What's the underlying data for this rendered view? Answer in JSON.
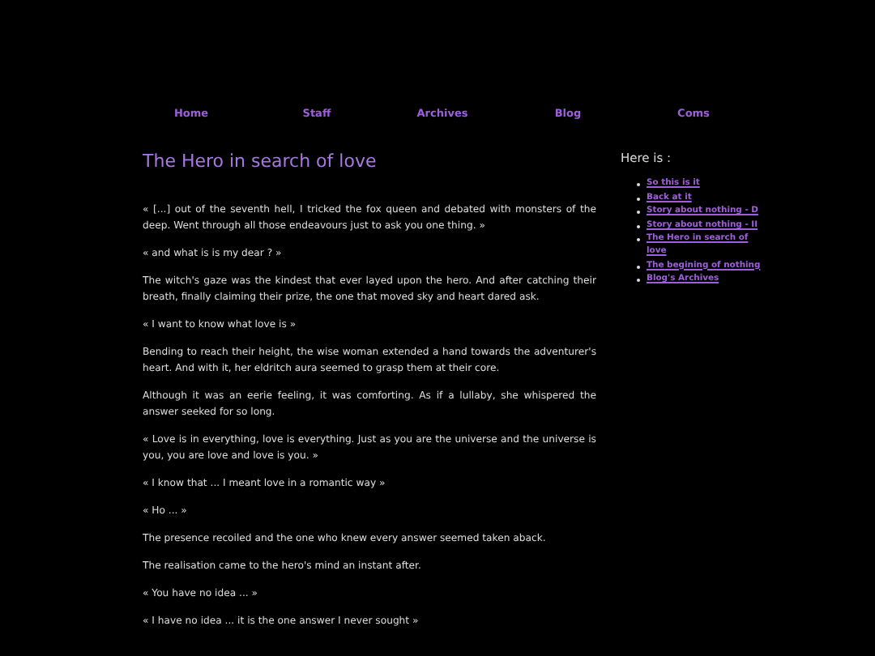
{
  "nav": [
    {
      "label": "Home"
    },
    {
      "label": "Staff"
    },
    {
      "label": "Archives"
    },
    {
      "label": "Blog"
    },
    {
      "label": "Coms"
    }
  ],
  "post": {
    "title": "The Hero in search of love",
    "paragraphs": [
      "« [...] out of the seventh hell, I tricked the fox queen and debated with monsters of the deep. Went through all those endeavours just to ask you one thing. »",
      "« and what is is my dear ? »",
      "The witch's gaze was the kindest that ever layed upon the hero. And after catching their breath, finally claiming their prize, the one that moved sky and heart dared ask.",
      "« I want to know what love is »",
      "Bending to reach their height, the wise woman extended a hand towards the adventurer's heart. And with it, her eldritch aura seemed to grasp them at their core.",
      "Although it was an eerie feeling, it was comforting. As if a lullaby, she whispered the answer seeked for so long.",
      "« Love is in everything, love is everything. Just as you are the universe and the universe is you, you are love and love is you. »",
      "« I know that ... I meant love in a romantic way »",
      "« Ho ... »",
      "The presence recoiled and the one who knew every answer seemed taken aback.",
      "The realisation came to the hero's mind an instant after.",
      "« You have no idea ... »",
      "« I have no idea ... it is the one answer I never sought »"
    ]
  },
  "sidebar": {
    "heading": "Here is :",
    "links": [
      {
        "label": "So this is it"
      },
      {
        "label": "Back at it"
      },
      {
        "label": "Story about nothing - D"
      },
      {
        "label": "Story about nothing - II"
      },
      {
        "label": "The Hero in search of love"
      },
      {
        "label": "The begining of nothing"
      },
      {
        "label": "Blog's Archives"
      }
    ]
  }
}
